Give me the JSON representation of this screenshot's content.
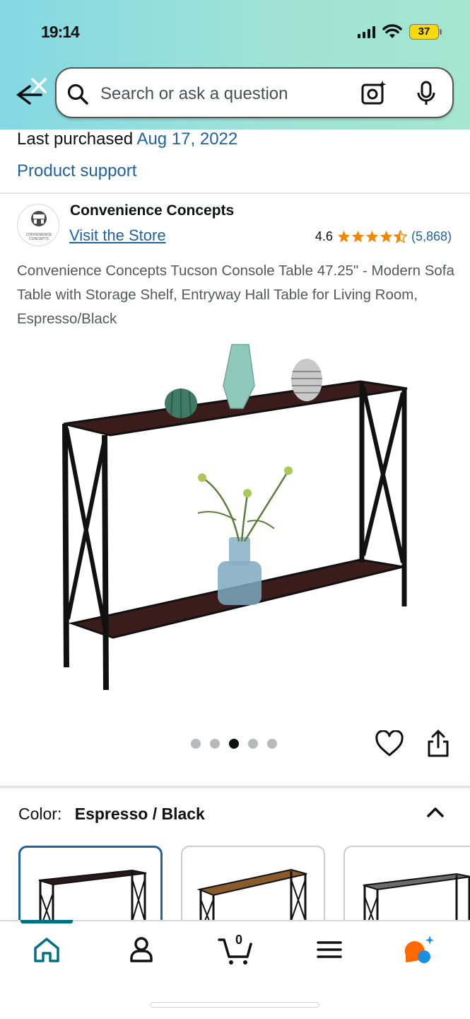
{
  "status_bar": {
    "time": "19:14",
    "battery": "37"
  },
  "search": {
    "placeholder": "Search or ask a question"
  },
  "purchase": {
    "last_purchased_label": "Last purchased",
    "last_purchased_date": "Aug 17, 2022",
    "product_support": "Product support"
  },
  "brand": {
    "name": "Convenience Concepts",
    "logo_text": "CONVENIENCE CONCEPTS",
    "visit_store": "Visit the Store"
  },
  "rating": {
    "value": "4.6",
    "stars": 4.5,
    "count": "(5,868)"
  },
  "product": {
    "title": "Convenience Concepts Tucson Console Table 47.25\" - Modern Sofa Table with Storage Shelf, Entryway Hall Table for Living Room, Espresso/Black",
    "image_count": 5,
    "active_image": 3
  },
  "color": {
    "label": "Color:",
    "value": "Espresso / Black"
  },
  "nav": {
    "cart_count": "0"
  },
  "colors": {
    "link": "#2162a1",
    "star": "#f08804",
    "accent": "#007185"
  }
}
